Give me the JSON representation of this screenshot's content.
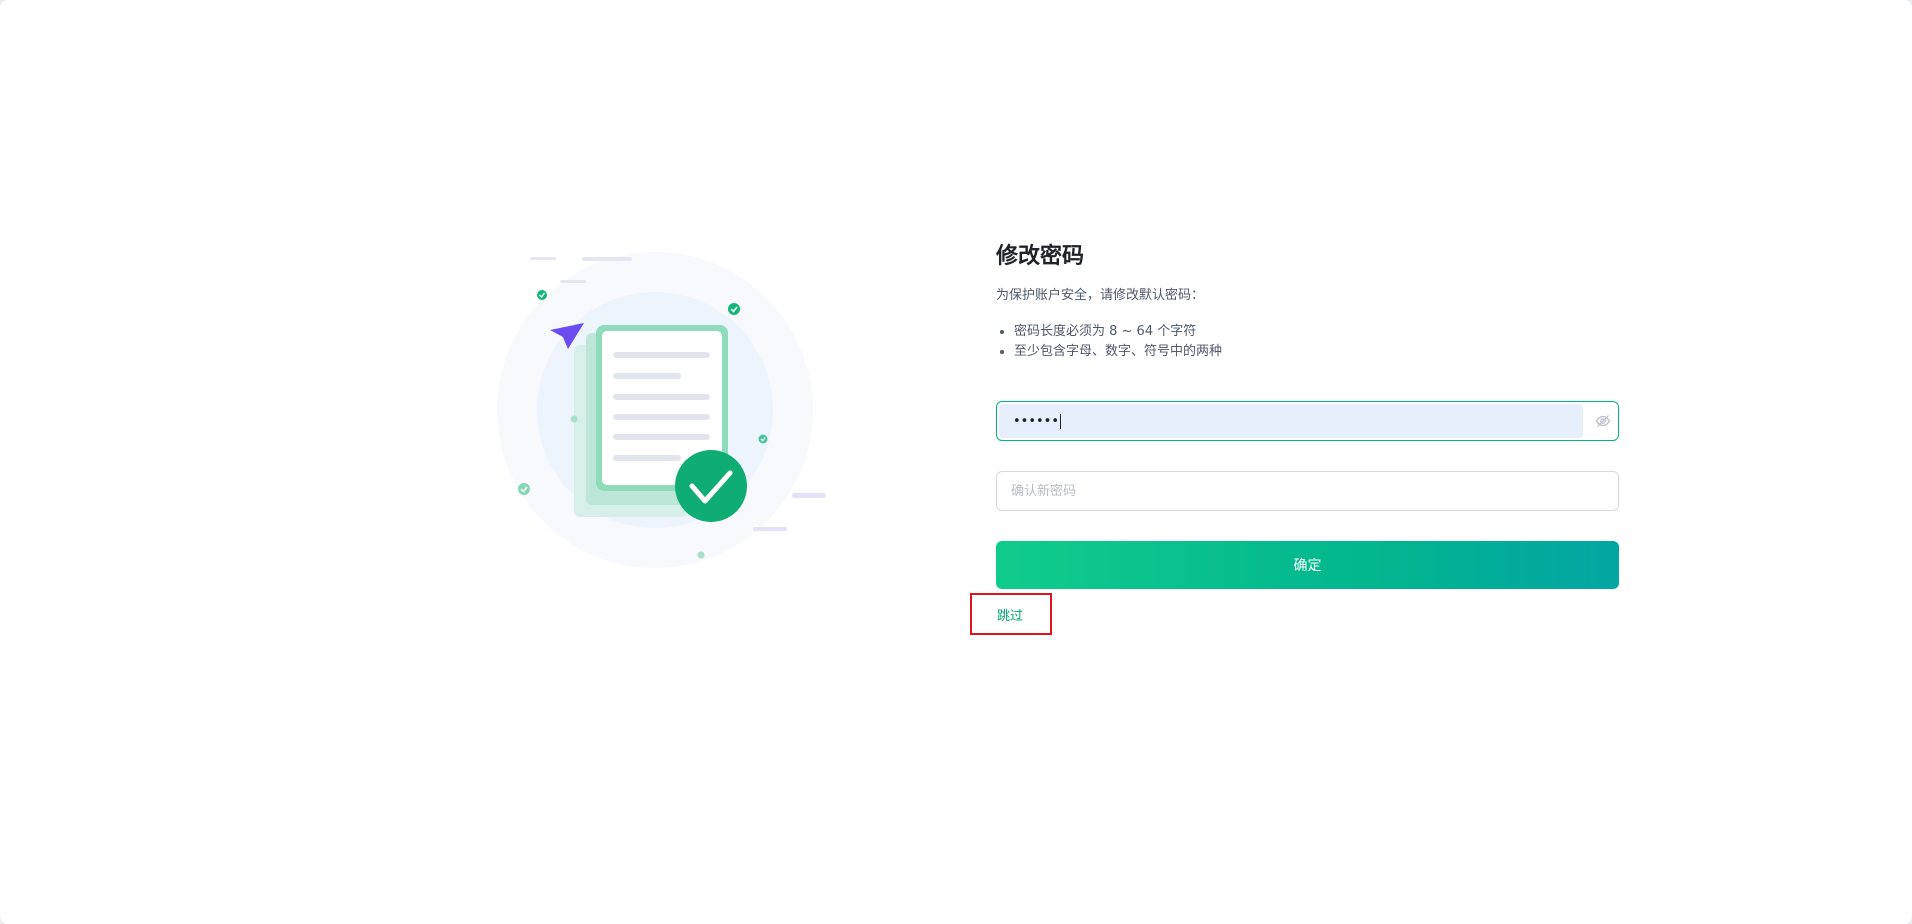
{
  "form": {
    "title": "修改密码",
    "description": "为保护账户安全，请修改默认密码：",
    "rules": [
      "密码长度必须为 8 ~ 64 个字符",
      "至少包含字母、数字、符号中的两种"
    ],
    "new_password": {
      "masked_value": "••••••",
      "visibility_icon": "eye-off-icon"
    },
    "confirm_password": {
      "placeholder": "确认新密码"
    },
    "submit_label": "确定",
    "skip_label": "跳过"
  },
  "colors": {
    "brand": "#00b779",
    "highlight_box": "#e0141e",
    "skip_link": "#00a870",
    "autofill_bg": "#e8effc"
  }
}
